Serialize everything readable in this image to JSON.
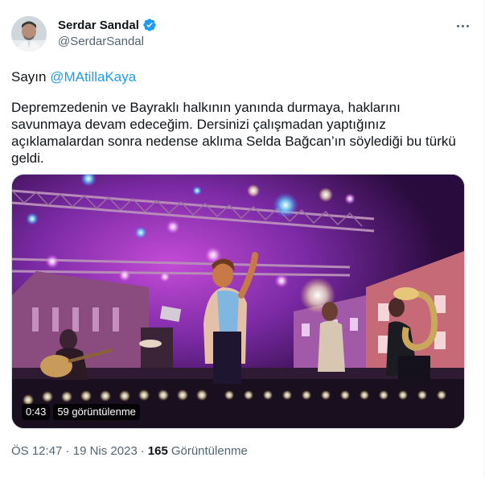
{
  "author": {
    "display_name": "Serdar Sandal",
    "handle": "@SerdarSandal",
    "verified_icon": "verified-badge-icon",
    "verified_color": "#1d9bf0"
  },
  "tweet": {
    "greeting": "Sayın ",
    "mention": "@MAtillaKaya",
    "text": "Depremzedenin ve Bayraklı halkının yanında durmaya, haklarını savunmaya devam edeceğim. Dersinizi çalışmadan yaptığınız açıklamalardan sonra nedense aklıma Selda Bağcan’ın söylediği bu türkü geldi."
  },
  "video": {
    "duration": "0:43",
    "views_label": "59 görüntülenme"
  },
  "meta": {
    "time": "ÖS 12:47",
    "separator1": " · ",
    "date": "19 Nis 2023",
    "separator2": " · ",
    "view_count": "165",
    "view_label": "Görüntülenme"
  },
  "colors": {
    "accent": "#1d9bf0",
    "text_primary": "#0f1419",
    "text_secondary": "#536471"
  }
}
